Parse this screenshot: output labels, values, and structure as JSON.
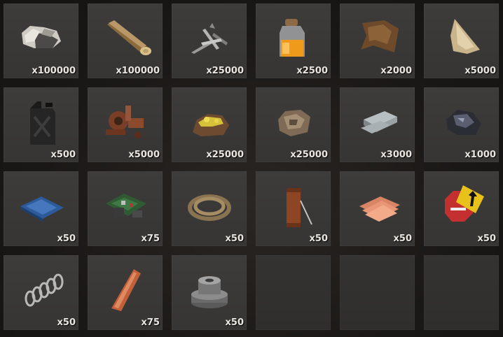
{
  "inventory": {
    "slots": [
      {
        "item": "stones",
        "icon": "stone-icon",
        "qty": "x100000"
      },
      {
        "item": "wood",
        "icon": "wood-log-icon",
        "qty": "x100000"
      },
      {
        "item": "metal fragments",
        "icon": "metal-fragments-icon",
        "qty": "x25000"
      },
      {
        "item": "low grade fuel",
        "icon": "fuel-jar-icon",
        "qty": "x2500"
      },
      {
        "item": "leather",
        "icon": "leather-icon",
        "qty": "x2000"
      },
      {
        "item": "cloth",
        "icon": "cloth-icon",
        "qty": "x5000"
      },
      {
        "item": "jerry can",
        "icon": "jerry-can-icon",
        "qty": "x500"
      },
      {
        "item": "scrap",
        "icon": "scrap-pile-icon",
        "qty": "x5000"
      },
      {
        "item": "sulfur ore",
        "icon": "sulfur-ore-icon",
        "qty": "x25000"
      },
      {
        "item": "metal ore",
        "icon": "metal-ore-icon",
        "qty": "x25000"
      },
      {
        "item": "high quality metal",
        "icon": "hqm-ingot-icon",
        "qty": "x3000"
      },
      {
        "item": "charcoal",
        "icon": "charcoal-icon",
        "qty": "x1000"
      },
      {
        "item": "tarp",
        "icon": "tarp-icon",
        "qty": "x50"
      },
      {
        "item": "tech trash",
        "icon": "tech-trash-icon",
        "qty": "x75"
      },
      {
        "item": "rope",
        "icon": "rope-icon",
        "qty": "x50"
      },
      {
        "item": "sewing kit",
        "icon": "sewing-kit-icon",
        "qty": "x50"
      },
      {
        "item": "sheet metal",
        "icon": "sheet-metal-icon",
        "qty": "x50"
      },
      {
        "item": "road signs",
        "icon": "road-sign-icon",
        "qty": "x50"
      },
      {
        "item": "metal spring",
        "icon": "spring-icon",
        "qty": "x50"
      },
      {
        "item": "metal blade",
        "icon": "metal-blade-icon",
        "qty": "x75"
      },
      {
        "item": "gears",
        "icon": "gears-icon",
        "qty": "x50"
      },
      {
        "item": "",
        "icon": "",
        "qty": ""
      },
      {
        "item": "",
        "icon": "",
        "qty": ""
      },
      {
        "item": "",
        "icon": "",
        "qty": ""
      }
    ]
  }
}
